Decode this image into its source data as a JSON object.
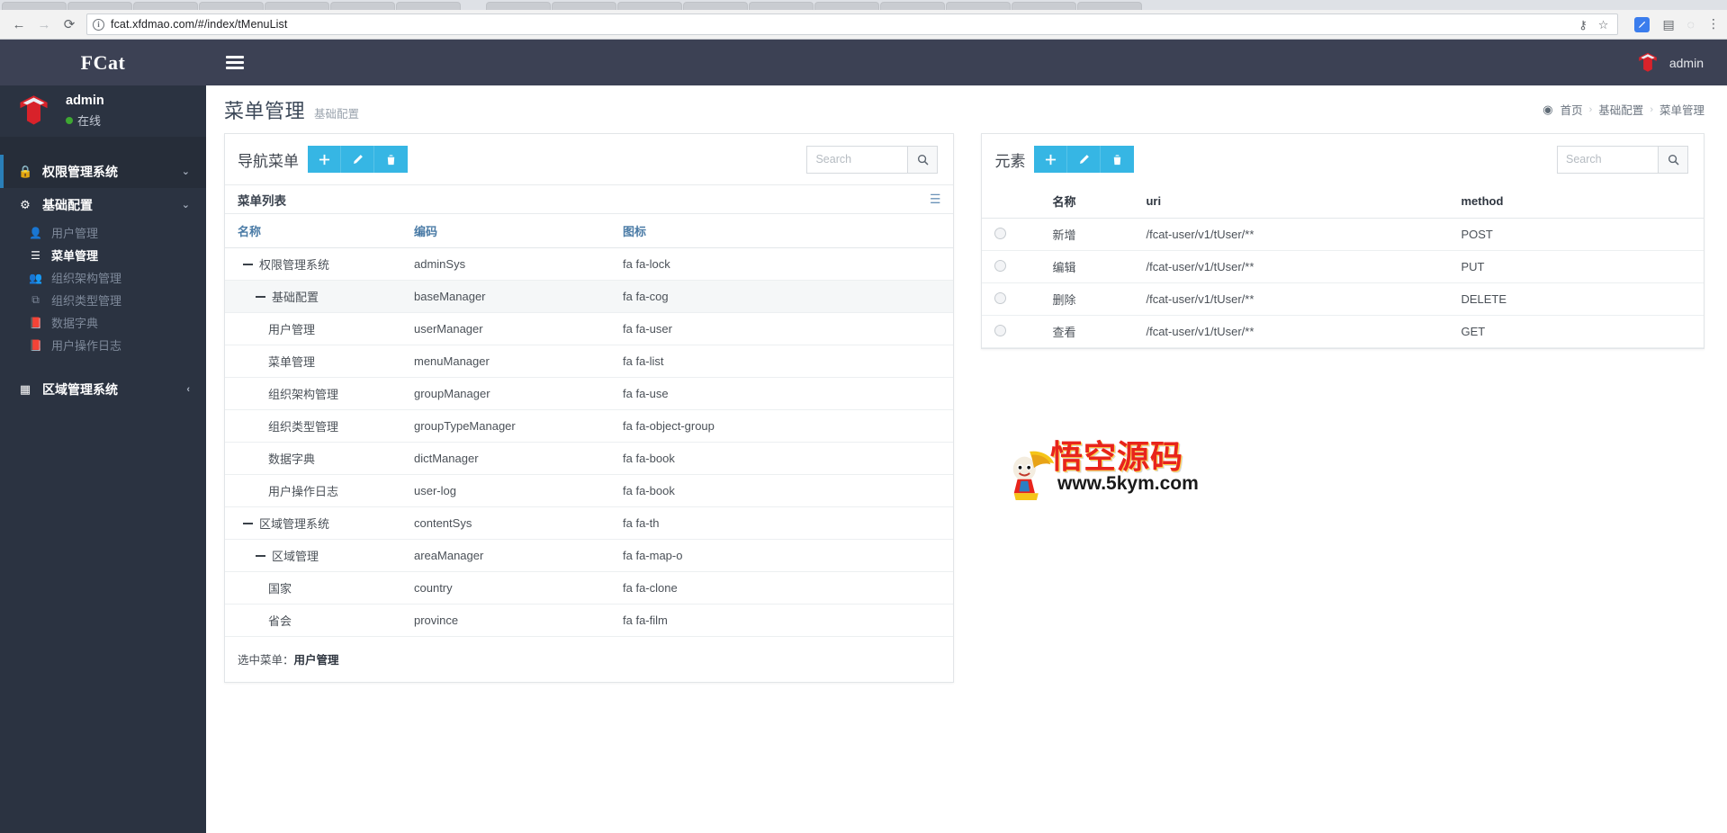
{
  "browser": {
    "back_icon": "back-arrow-icon",
    "forward_icon": "forward-arrow-icon",
    "reload_icon": "reload-icon",
    "site_info_icon": "info-circle-icon",
    "url": "fcat.xfdmao.com/#/index/tMenuList",
    "url_scheme_part": "",
    "key_icon": "key-icon",
    "bookmark_icon": "star-icon",
    "extension_icon": "extension-icon",
    "sidepanel_icon": "side-panel-icon",
    "cast_icon": "cast-icon",
    "menu_icon": "kebab-menu-icon"
  },
  "navbar": {
    "brand": "FCat",
    "toggle_icon": "hamburger-icon",
    "user_name": "admin",
    "logo_icon": "fcat-logo-icon"
  },
  "sidebar": {
    "user": {
      "name": "admin",
      "status": "在线",
      "avatar_icon": "fcat-logo-avatar-icon"
    },
    "items": [
      {
        "label": "权限管理系统",
        "icon": "lock-icon",
        "type": "group",
        "active": true,
        "chevron": "chevron-down-icon"
      },
      {
        "label": "基础配置",
        "icon": "gear-icon",
        "type": "group",
        "active": false,
        "chevron": "chevron-down-icon"
      },
      {
        "label": "用户管理",
        "icon": "user-icon",
        "type": "sub",
        "active": false
      },
      {
        "label": "菜单管理",
        "icon": "list-icon",
        "type": "sub",
        "active": true
      },
      {
        "label": "组织架构管理",
        "icon": "users-icon",
        "type": "sub",
        "active": false
      },
      {
        "label": "组织类型管理",
        "icon": "object-group-icon",
        "type": "sub",
        "active": false
      },
      {
        "label": "数据字典",
        "icon": "book-icon",
        "type": "sub",
        "active": false
      },
      {
        "label": "用户操作日志",
        "icon": "book-icon",
        "type": "sub",
        "active": false
      },
      {
        "label": "区域管理系统",
        "icon": "grid-icon",
        "type": "group",
        "active": false,
        "chevron": "chevron-left-icon"
      }
    ]
  },
  "page": {
    "title": "菜单管理",
    "subtitle": "基础配置",
    "breadcrumb": {
      "home_icon": "dashboard-icon",
      "items": [
        "首页",
        "基础配置",
        "菜单管理"
      ],
      "separator": "›"
    }
  },
  "left_panel": {
    "title": "导航菜单",
    "buttons": [
      {
        "name": "add-button",
        "icon": "plus-icon"
      },
      {
        "name": "edit-button",
        "icon": "pencil-icon"
      },
      {
        "name": "delete-button",
        "icon": "trash-icon"
      }
    ],
    "search": {
      "value": "",
      "placeholder": "Search",
      "icon": "search-icon"
    },
    "subtitle": "菜单列表",
    "subtitle_icon": "list-view-icon",
    "columns": [
      "名称",
      "编码",
      "图标"
    ],
    "rows": [
      {
        "name": "权限管理系统",
        "code": "adminSys",
        "icon": "fa fa-lock",
        "indent": 0,
        "expandable": true,
        "selected": false
      },
      {
        "name": "基础配置",
        "code": "baseManager",
        "icon": "fa fa-cog",
        "indent": 1,
        "expandable": true,
        "selected": true
      },
      {
        "name": "用户管理",
        "code": "userManager",
        "icon": "fa fa-user",
        "indent": 2,
        "expandable": false,
        "selected": false
      },
      {
        "name": "菜单管理",
        "code": "menuManager",
        "icon": "fa fa-list",
        "indent": 2,
        "expandable": false,
        "selected": false
      },
      {
        "name": "组织架构管理",
        "code": "groupManager",
        "icon": "fa fa-use",
        "indent": 2,
        "expandable": false,
        "selected": false
      },
      {
        "name": "组织类型管理",
        "code": "groupTypeManager",
        "icon": "fa fa-object-group",
        "indent": 2,
        "expandable": false,
        "selected": false
      },
      {
        "name": "数据字典",
        "code": "dictManager",
        "icon": "fa fa-book",
        "indent": 2,
        "expandable": false,
        "selected": false
      },
      {
        "name": "用户操作日志",
        "code": "user-log",
        "icon": "fa fa-book",
        "indent": 2,
        "expandable": false,
        "selected": false
      },
      {
        "name": "区域管理系统",
        "code": "contentSys",
        "icon": "fa fa-th",
        "indent": 0,
        "expandable": true,
        "selected": false
      },
      {
        "name": "区域管理",
        "code": "areaManager",
        "icon": "fa fa-map-o",
        "indent": 1,
        "expandable": true,
        "selected": false
      },
      {
        "name": "国家",
        "code": "country",
        "icon": "fa fa-clone",
        "indent": 2,
        "expandable": false,
        "selected": false
      },
      {
        "name": "省会",
        "code": "province",
        "icon": "fa fa-film",
        "indent": 2,
        "expandable": false,
        "selected": false
      }
    ],
    "footer_label": "选中菜单：",
    "footer_value": "用户管理"
  },
  "right_panel": {
    "title": "元素",
    "buttons": [
      {
        "name": "add-button",
        "icon": "plus-icon"
      },
      {
        "name": "edit-button",
        "icon": "pencil-icon"
      },
      {
        "name": "delete-button",
        "icon": "trash-icon"
      }
    ],
    "search": {
      "value": "",
      "placeholder": "Search",
      "icon": "search-icon"
    },
    "columns": [
      "",
      "名称",
      "uri",
      "method"
    ],
    "rows": [
      {
        "name": "新增",
        "uri": "/fcat-user/v1/tUser/**",
        "method": "POST"
      },
      {
        "name": "编辑",
        "uri": "/fcat-user/v1/tUser/**",
        "method": "PUT"
      },
      {
        "name": "删除",
        "uri": "/fcat-user/v1/tUser/**",
        "method": "DELETE"
      },
      {
        "name": "查看",
        "uri": "/fcat-user/v1/tUser/**",
        "method": "GET"
      }
    ]
  },
  "watermark": {
    "text": "悟空源码",
    "url": "www.5kym.com"
  },
  "colors": {
    "navbar": "#3c4154",
    "sidebar": "#2b3341",
    "accent_blue": "#36b6e4",
    "link_blue": "#4a7ba6",
    "logo_red": "#d8222a",
    "online_green": "#3ea832"
  }
}
